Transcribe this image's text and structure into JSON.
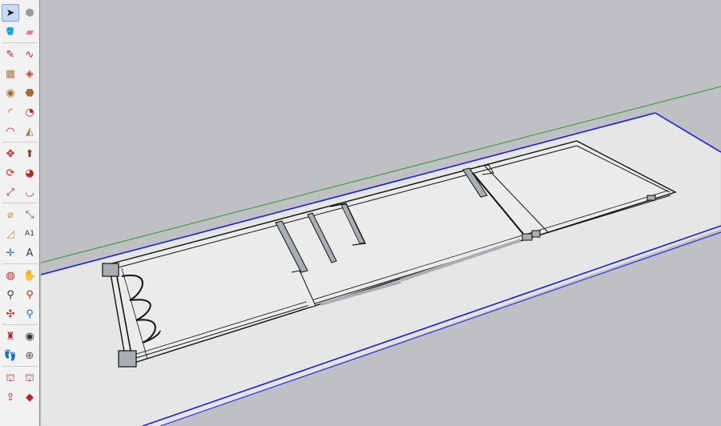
{
  "toolbar": {
    "tools": [
      {
        "name": "select-tool-icon",
        "glyph": "➤",
        "color": "#222222",
        "active": true
      },
      {
        "name": "component-tool-icon",
        "glyph": "⬢",
        "color": "#9a9a9a"
      },
      {
        "name": "paint-bucket-tool-icon",
        "glyph": "🪣",
        "color": "#c7961a"
      },
      {
        "name": "eraser-tool-icon",
        "glyph": "▰",
        "color": "#e07a9a"
      },
      {
        "name": "line-tool-icon",
        "glyph": "✎",
        "color": "#c0241c"
      },
      {
        "name": "freehand-tool-icon",
        "glyph": "∿",
        "color": "#c0241c"
      },
      {
        "name": "rectangle-tool-icon",
        "glyph": "▦",
        "color": "#b07a3a"
      },
      {
        "name": "rotated-rectangle-tool-icon",
        "glyph": "◈",
        "color": "#b04a2a"
      },
      {
        "name": "circle-tool-icon",
        "glyph": "◉",
        "color": "#a07030"
      },
      {
        "name": "polygon-tool-icon",
        "glyph": "⬣",
        "color": "#a07030"
      },
      {
        "name": "arc-tool-icon",
        "glyph": "◜",
        "color": "#c0241c"
      },
      {
        "name": "pie-tool-icon",
        "glyph": "◔",
        "color": "#c0241c"
      },
      {
        "name": "three-point-arc-tool-icon",
        "glyph": "◠",
        "color": "#c0241c"
      },
      {
        "name": "two-point-arc-tool-icon",
        "glyph": "◭",
        "color": "#b07a3a"
      },
      {
        "name": "move-tool-icon",
        "glyph": "✥",
        "color": "#c0241c"
      },
      {
        "name": "push-pull-tool-icon",
        "glyph": "⬆",
        "color": "#8a3a2a"
      },
      {
        "name": "rotate-tool-icon",
        "glyph": "⟳",
        "color": "#c0241c"
      },
      {
        "name": "follow-me-tool-icon",
        "glyph": "◕",
        "color": "#c0241c"
      },
      {
        "name": "scale-tool-icon",
        "glyph": "⤢",
        "color": "#c0241c"
      },
      {
        "name": "offset-tool-icon",
        "glyph": "◡",
        "color": "#c0241c"
      },
      {
        "name": "tape-measure-tool-icon",
        "glyph": "⌀",
        "color": "#c7961a"
      },
      {
        "name": "dimension-tool-icon",
        "glyph": "⤡",
        "color": "#555555"
      },
      {
        "name": "protractor-tool-icon",
        "glyph": "◿",
        "color": "#c7961a"
      },
      {
        "name": "text-tool-icon",
        "glyph": "A1",
        "color": "#333333"
      },
      {
        "name": "axes-tool-icon",
        "glyph": "✛",
        "color": "#2a6ad0"
      },
      {
        "name": "3d-text-tool-icon",
        "glyph": "A",
        "color": "#444444"
      },
      {
        "name": "orbit-tool-icon",
        "glyph": "◍",
        "color": "#c0241c"
      },
      {
        "name": "pan-tool-icon",
        "glyph": "✋",
        "color": "#c7961a"
      },
      {
        "name": "zoom-tool-icon",
        "glyph": "⚲",
        "color": "#333333"
      },
      {
        "name": "zoom-window-tool-icon",
        "glyph": "⚲",
        "color": "#c0241c"
      },
      {
        "name": "zoom-extents-tool-icon",
        "glyph": "✣",
        "color": "#c0241c"
      },
      {
        "name": "previous-view-tool-icon",
        "glyph": "⚲",
        "color": "#2a6ad0"
      },
      {
        "name": "position-camera-tool-icon",
        "glyph": "♜",
        "color": "#c0241c"
      },
      {
        "name": "look-around-tool-icon",
        "glyph": "◉",
        "color": "#333333"
      },
      {
        "name": "walk-tool-icon",
        "glyph": "👣",
        "color": "#333333"
      },
      {
        "name": "section-plane-tool-icon",
        "glyph": "⊕",
        "color": "#555555"
      },
      {
        "name": "warehouse-tool-icon",
        "glyph": "⛫",
        "color": "#c0241c"
      },
      {
        "name": "extension-warehouse-tool-icon",
        "glyph": "⛫",
        "color": "#c0241c"
      },
      {
        "name": "share-model-tool-icon",
        "glyph": "⇪",
        "color": "#c0241c"
      },
      {
        "name": "extension-manager-tool-icon",
        "glyph": "◆",
        "color": "#c0241c"
      }
    ]
  },
  "viewport": {
    "colors": {
      "sky": "#bfc0c4",
      "ground": "#e6e6e6",
      "red_axis": "#e0201c",
      "green_axis": "#2a9a2a",
      "blue_axis": "#1a1ae8",
      "wall": "#a9aeb3",
      "edge": "#111111"
    }
  }
}
